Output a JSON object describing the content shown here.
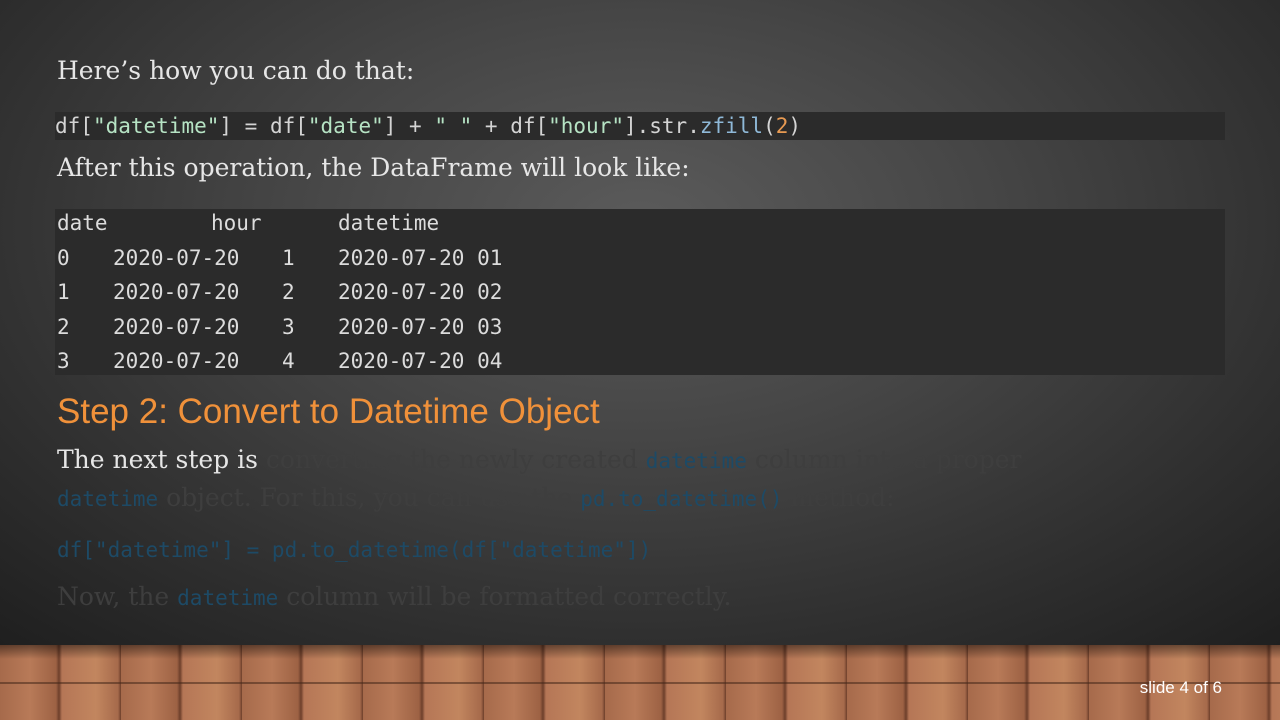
{
  "slide": {
    "intro_text": "Here’s how you can do that:",
    "code_line_1": {
      "t1": "df[",
      "s1": "\"datetime\"",
      "t2": "] = df[",
      "s2": "\"date\"",
      "t3": "] + ",
      "s3": "\" \"",
      "t4": " + df[",
      "s4": "\"hour\"",
      "t5": "].str.",
      "fn": "zfill",
      "t6": "(",
      "num": "2",
      "t7": ")"
    },
    "after_text": "After this operation, the DataFrame will look like:",
    "table": {
      "headers": [
        "date",
        "hour",
        "datetime"
      ],
      "rows": [
        [
          "0",
          "2020-07-20",
          "1",
          "2020-07-20 01"
        ],
        [
          "1",
          "2020-07-20",
          "2",
          "2020-07-20 02"
        ],
        [
          "2",
          "2020-07-20",
          "3",
          "2020-07-20 03"
        ],
        [
          "3",
          "2020-07-20",
          "4",
          "2020-07-20 04"
        ]
      ]
    },
    "step2_heading": "Step 2: Convert to Datetime Object",
    "step2_para": {
      "visible": "The next step is ",
      "faded_1": "converting the newly created ",
      "code_1": "datetime",
      "faded_2": " column into a proper",
      "code_2": "datetime",
      "faded_3": " object. For this, you can use the ",
      "code_3": "pd.to_datetime()",
      "faded_4": " method:"
    },
    "code_line_2": "df[\"datetime\"] = pd.to_datetime(df[\"datetime\"])",
    "final_para": {
      "faded_1": "Now, the ",
      "code_1": "datetime",
      "faded_2": " column will be formatted correctly."
    },
    "slide_number": "slide 4 of 6"
  },
  "colors": {
    "heading_orange": "#f0913a",
    "string_green": "#b6e3c4",
    "function_blue": "#8fb9d8",
    "number_orange": "#e89a52",
    "code_bg": "#2b2b2b"
  }
}
